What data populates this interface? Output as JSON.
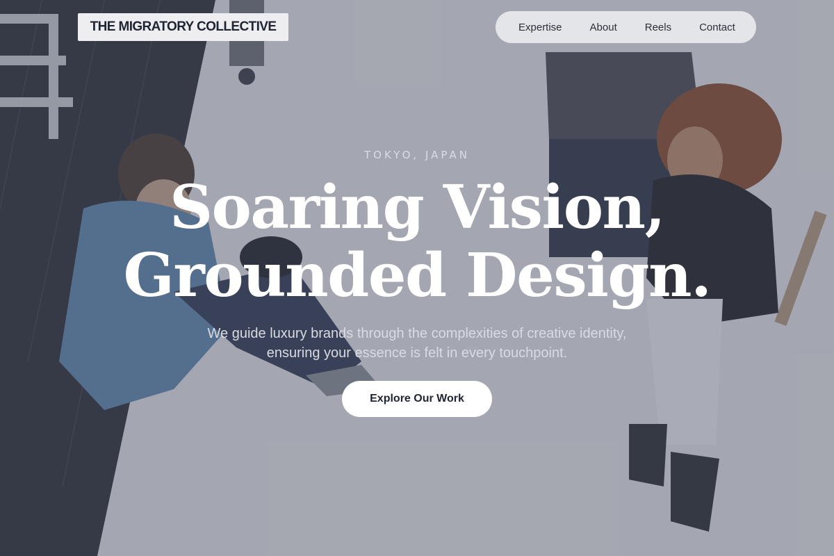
{
  "header": {
    "logo_text": "THE MIGRATORY COLLECTIVE",
    "nav_items": [
      {
        "label": "Expertise"
      },
      {
        "label": "About"
      },
      {
        "label": "Reels"
      },
      {
        "label": "Contact"
      }
    ]
  },
  "hero": {
    "kicker": "TOKYO, JAPAN",
    "headline_lines": [
      "Soaring Vision,",
      "Grounded Design."
    ],
    "subtitle_lines": [
      "We guide luxury brands through the complexities of creative identity,",
      "ensuring your essence is felt in every touchpoint."
    ],
    "cta_label": "Explore Our Work"
  },
  "colors": {
    "overlay": "#464c60",
    "nav_background": "#e8e9ed",
    "logo_background": "#eeeef0",
    "text_dark": "#1f2433",
    "headline": "#ffffff"
  }
}
